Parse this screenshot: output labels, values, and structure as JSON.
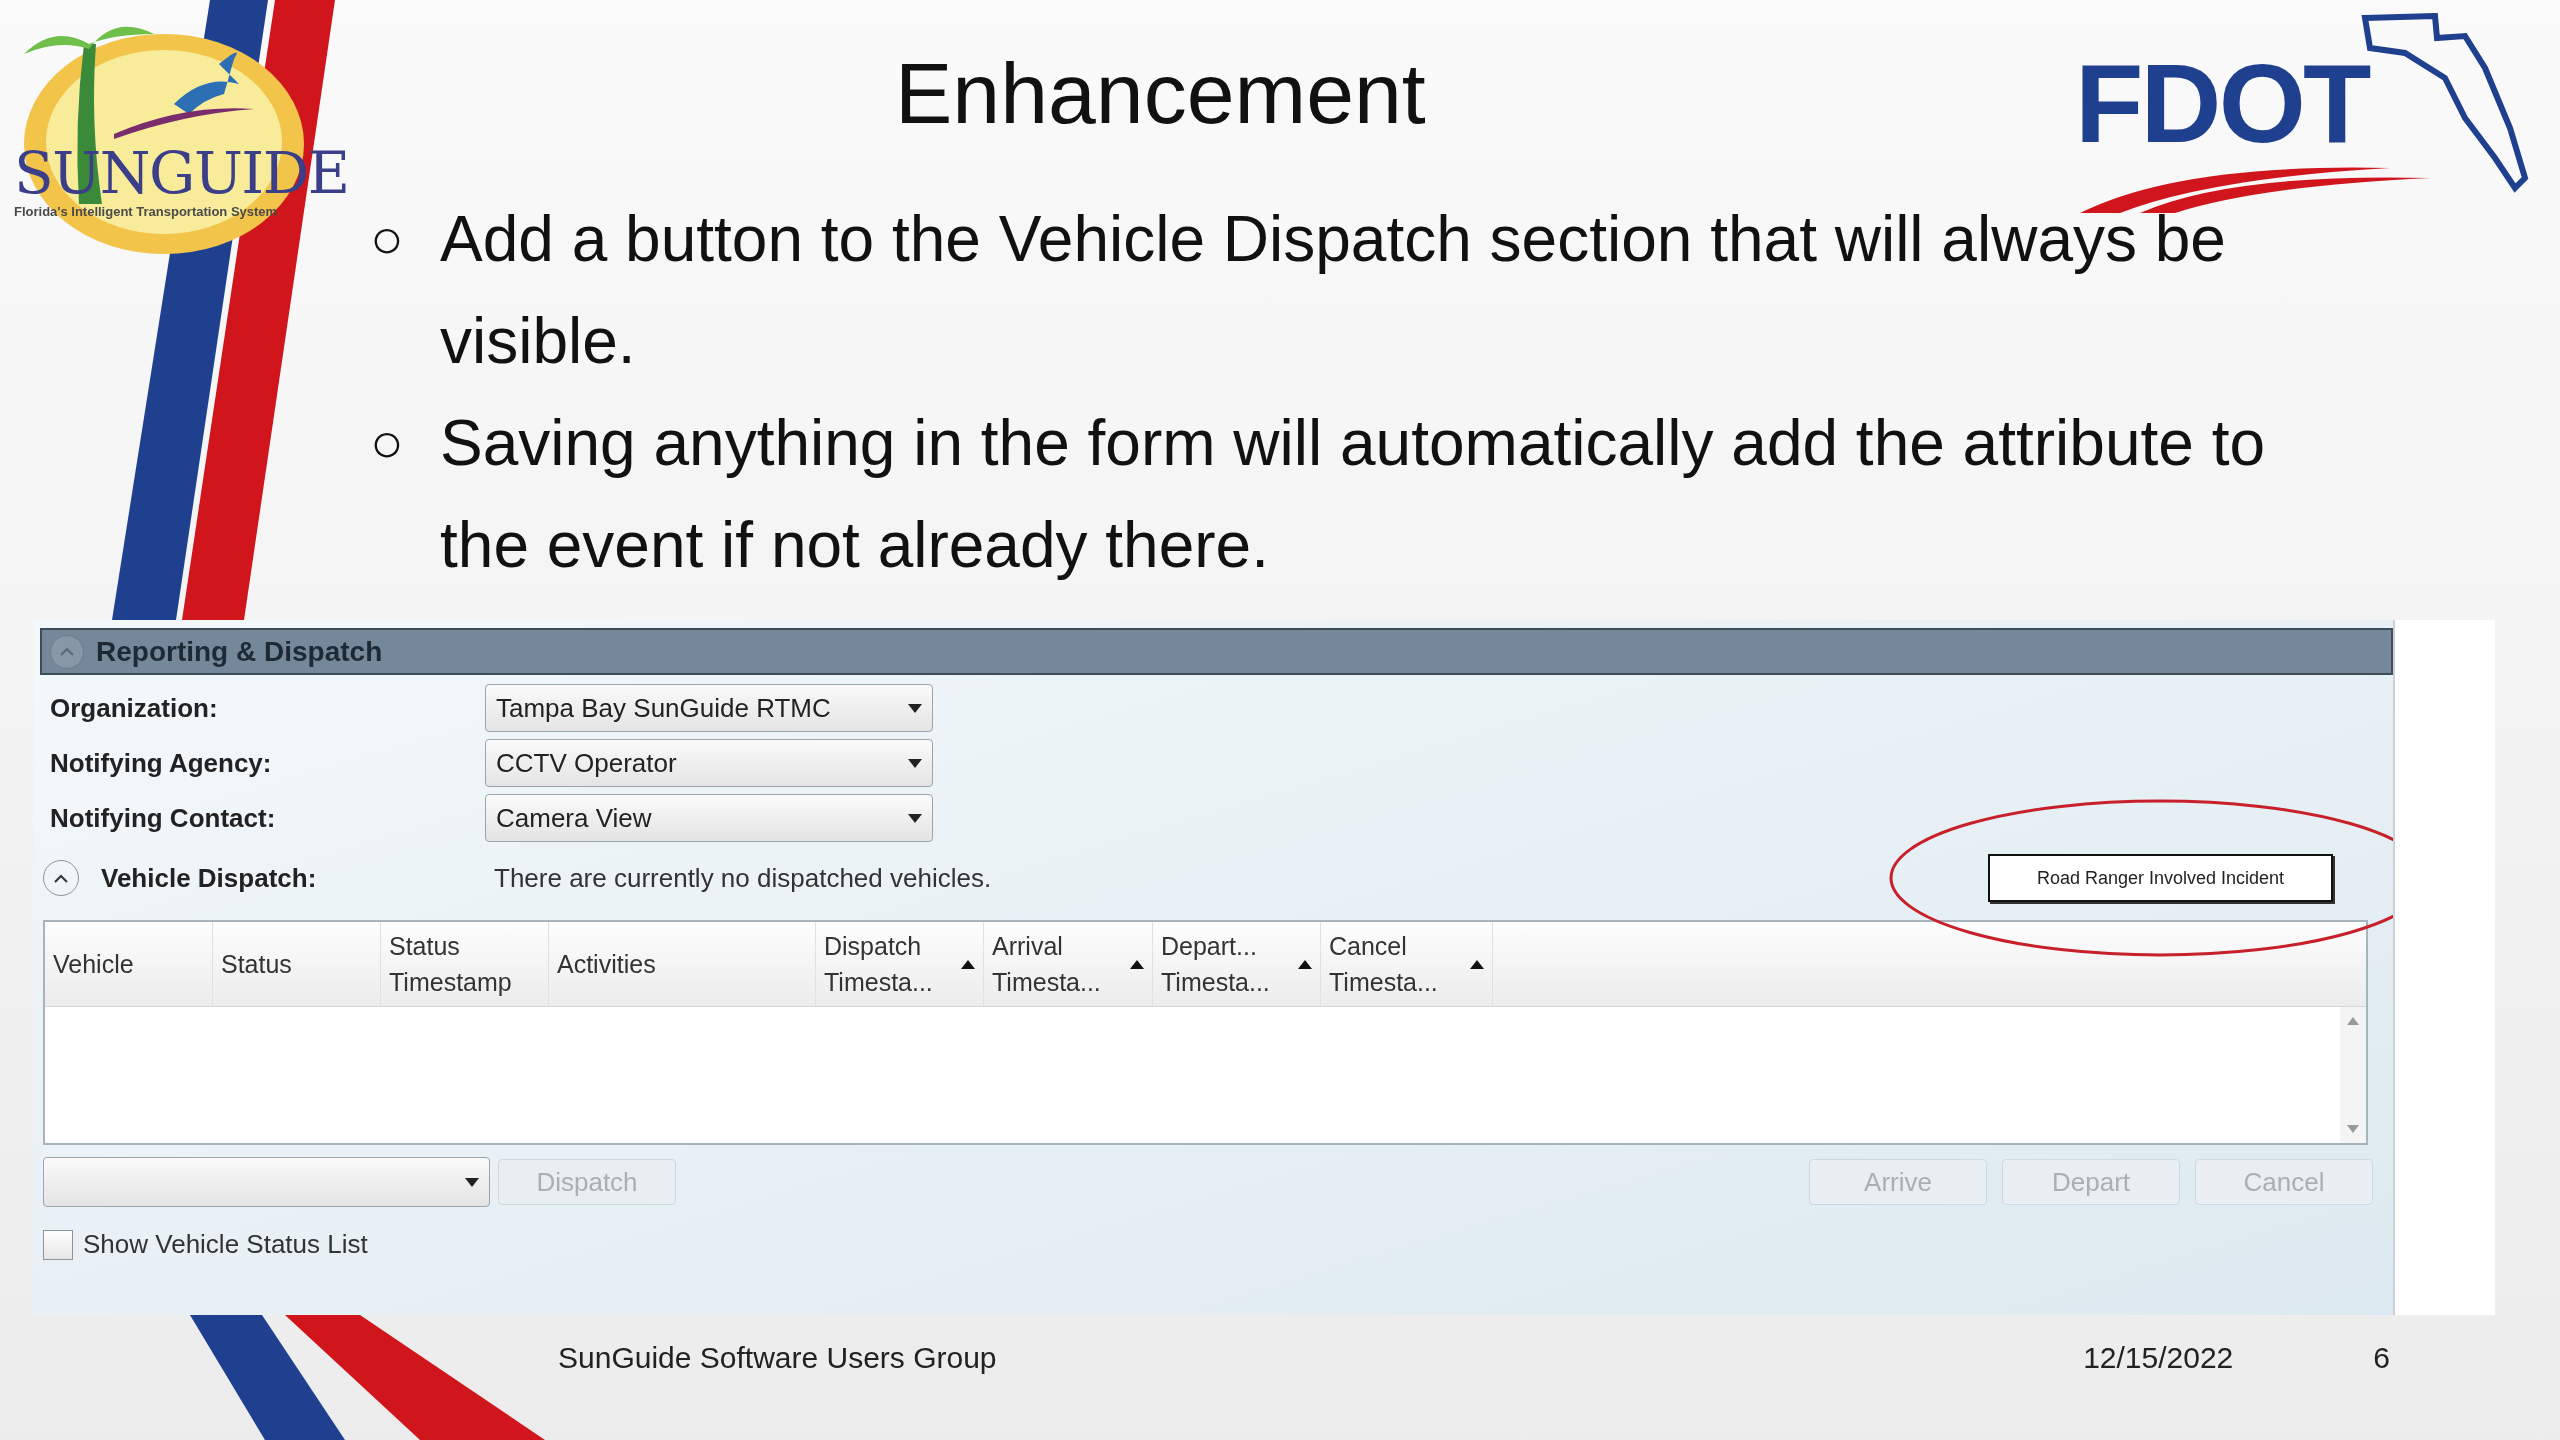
{
  "logos": {
    "left": {
      "name": "SUNGUIDE",
      "tagline": "Florida's Intelligent Transportation System"
    },
    "right": {
      "name": "FDOT"
    }
  },
  "title": "Enhancement",
  "bullets": [
    {
      "marker": "○",
      "text": "Add a button to the Vehicle Dispatch section that will always be visible."
    },
    {
      "marker": "○",
      "text": "Saving anything in the form will automatically add the attribute to the event if not already there."
    }
  ],
  "screenshot": {
    "section": {
      "title": "Reporting & Dispatch",
      "expanded": true
    },
    "fields": [
      {
        "label": "Organization:",
        "value": "Tampa Bay SunGuide RTMC"
      },
      {
        "label": "Notifying Agency:",
        "value": "CCTV Operator"
      },
      {
        "label": "Notifying Contact:",
        "value": "Camera View"
      }
    ],
    "vehicle_dispatch": {
      "label": "Vehicle Dispatch:",
      "message": "There are currently no dispatched vehicles.",
      "expanded": true
    },
    "highlight_button": {
      "label": "Road Ranger Involved Incident",
      "circled": true
    },
    "columns": [
      {
        "lines": [
          "Vehicle"
        ],
        "sort_arrow": false
      },
      {
        "lines": [
          "Status"
        ],
        "sort_arrow": false
      },
      {
        "lines": [
          "Status",
          "Timestamp"
        ],
        "sort_arrow": false
      },
      {
        "lines": [
          "Activities"
        ],
        "sort_arrow": false
      },
      {
        "lines": [
          "Dispatch",
          "Timesta..."
        ],
        "sort_arrow": true
      },
      {
        "lines": [
          "Arrival",
          "Timesta..."
        ],
        "sort_arrow": true
      },
      {
        "lines": [
          "Depart...",
          "Timesta..."
        ],
        "sort_arrow": true
      },
      {
        "lines": [
          "Cancel",
          "Timesta..."
        ],
        "sort_arrow": true
      }
    ],
    "left_buttons": [
      {
        "label": "Dispatch",
        "disabled": true
      }
    ],
    "right_buttons": [
      {
        "label": "Arrive",
        "disabled": true
      },
      {
        "label": "Depart",
        "disabled": true
      },
      {
        "label": "Cancel",
        "disabled": true
      }
    ],
    "checkbox": {
      "label": "Show Vehicle Status List",
      "checked": false
    }
  },
  "footer": {
    "text": "SunGuide Software Users Group",
    "date": "12/15/2022",
    "page": "6"
  }
}
